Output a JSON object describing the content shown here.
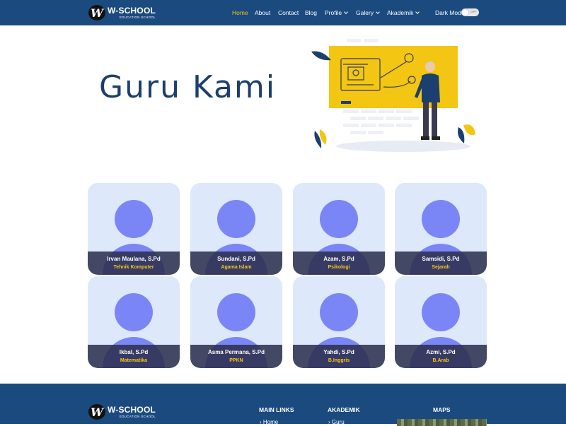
{
  "brand": {
    "logo_letter": "W",
    "title": "W-SCHOOL",
    "subtitle": "EDUCATION SCHOOL"
  },
  "nav": {
    "items": [
      {
        "label": "Home",
        "active": true
      },
      {
        "label": "About"
      },
      {
        "label": "Contact"
      },
      {
        "label": "Blog"
      },
      {
        "label": "Profile",
        "dropdown": true
      },
      {
        "label": "Galery",
        "dropdown": true
      },
      {
        "label": "Akademik",
        "dropdown": true
      }
    ],
    "dark_mode_label": "Dark Mode",
    "toggle_text": "OFF",
    "dark_mode_on": false
  },
  "hero": {
    "title": "Guru Kami"
  },
  "teachers": [
    {
      "name": "Irvan Maulana, S.Pd",
      "subject": "Tehnik Komputer"
    },
    {
      "name": "Sundani, S.Pd",
      "subject": "Agama Islam"
    },
    {
      "name": "Azam, S.Pd",
      "subject": "Psikologi"
    },
    {
      "name": "Samsidi, S.Pd",
      "subject": "Sejarah"
    },
    {
      "name": "Ikbal, S.Pd",
      "subject": "Matematika"
    },
    {
      "name": "Asma Permana, S.Pd",
      "subject": "PPKN"
    },
    {
      "name": "Yahdi, S.Pd",
      "subject": "B.Inggris"
    },
    {
      "name": "Azmi, S.Pd",
      "subject": "B.Arab"
    }
  ],
  "footer": {
    "main_links_heading": "MAIN LINKS",
    "main_links": [
      "Home"
    ],
    "akademik_heading": "AKADEMIK",
    "akademik_links": [
      "Guru"
    ],
    "maps_heading": "MAPS"
  },
  "colors": {
    "navbar": "#1b4a7e",
    "accent": "#f5c518",
    "card_bg": "#dde8fb",
    "avatar": "#7b86f6",
    "hero_title": "#1b3f6e"
  }
}
